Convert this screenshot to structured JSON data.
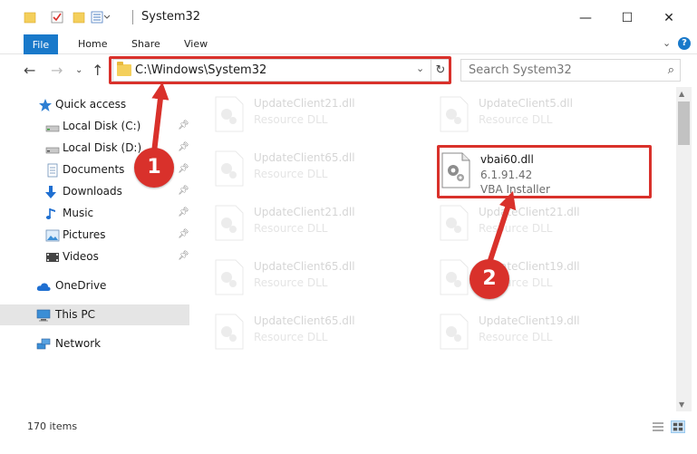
{
  "window": {
    "title": "System32",
    "minimize_glyph": "—",
    "maximize_glyph": "☐",
    "close_glyph": "✕"
  },
  "ribbon": {
    "file_label": "File",
    "tabs": [
      "Home",
      "Share",
      "View"
    ],
    "help_glyph": "?"
  },
  "navigation": {
    "address": "C:\\Windows\\System32",
    "search_placeholder": "Search System32"
  },
  "sidebar": {
    "items": [
      {
        "label": "Quick access",
        "icon": "star-icon",
        "pinned": false
      },
      {
        "label": "Local Disk (C:)",
        "icon": "drive-icon",
        "pinned": true
      },
      {
        "label": "Local Disk (D:)",
        "icon": "drive-icon",
        "pinned": true
      },
      {
        "label": "Documents",
        "icon": "documents-icon",
        "pinned": true
      },
      {
        "label": "Downloads",
        "icon": "download-icon",
        "pinned": true
      },
      {
        "label": "Music",
        "icon": "music-icon",
        "pinned": true
      },
      {
        "label": "Pictures",
        "icon": "pictures-icon",
        "pinned": true
      },
      {
        "label": "Videos",
        "icon": "videos-icon",
        "pinned": true
      },
      {
        "label": "OneDrive",
        "icon": "cloud-icon",
        "pinned": false
      },
      {
        "label": "This PC",
        "icon": "computer-icon",
        "pinned": false,
        "selected": true
      },
      {
        "label": "Network",
        "icon": "network-icon",
        "pinned": false
      }
    ]
  },
  "files": {
    "left": [
      {
        "name": "UpdateClient21.dll",
        "type": "Resource DLL"
      },
      {
        "name": "UpdateClient65.dll",
        "type": "Resource DLL"
      },
      {
        "name": "UpdateClient21.dll",
        "type": "Resource DLL"
      },
      {
        "name": "UpdateClient65.dll",
        "type": "Resource DLL"
      },
      {
        "name": "UpdateClient65.dll",
        "type": "Resource DLL"
      }
    ],
    "right": [
      {
        "name": "UpdateClient5.dll",
        "type": "Resource DLL"
      },
      {
        "name": "vbai60.dll",
        "type": "6.1.91.42",
        "sub": "VBA Installer",
        "highlighted": true
      },
      {
        "name": "UpdateClient21.dll",
        "type": "Resource DLL"
      },
      {
        "name": "UpdateClient19.dll",
        "type": "Resource DLL"
      },
      {
        "name": "UpdateClient19.dll",
        "type": "Resource DLL"
      }
    ]
  },
  "status": {
    "item_count": "170 items"
  },
  "callouts": {
    "one": "1",
    "two": "2"
  },
  "colors": {
    "accent": "#1979ca",
    "highlight_red": "#d9312b",
    "selected_bg": "#e5e5e5"
  }
}
